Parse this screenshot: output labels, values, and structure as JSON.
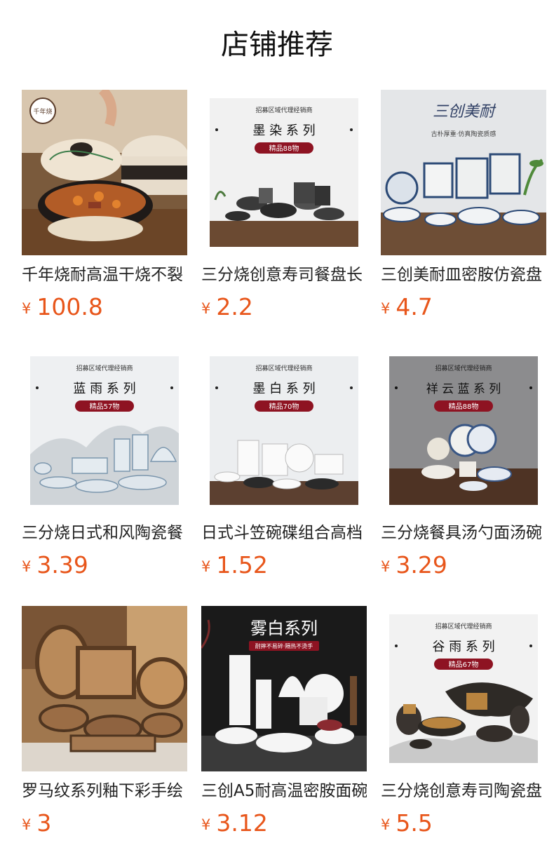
{
  "header": {
    "title": "店铺推荐"
  },
  "currency": "¥",
  "products": [
    {
      "name": "千年烧耐高温干烧不裂",
      "price": "100.8"
    },
    {
      "name": "三分烧创意寿司餐盘长",
      "price": "2.2"
    },
    {
      "name": "三创美耐皿密胺仿瓷盘",
      "price": "4.7"
    },
    {
      "name": "三分烧日式和风陶瓷餐",
      "price": "3.39"
    },
    {
      "name": "日式斗笠碗碟组合高档",
      "price": "1.52"
    },
    {
      "name": "三分烧餐具汤勺面汤碗",
      "price": "3.29"
    },
    {
      "name": "罗马纹系列釉下彩手绘",
      "price": "3"
    },
    {
      "name": "三创A5耐高温密胺面碗",
      "price": "3.12"
    },
    {
      "name": "三分烧创意寿司陶瓷盘",
      "price": "5.5"
    }
  ],
  "banners": {
    "moran": {
      "top": "招募区域代理经销商",
      "series": "墨 染 系 列",
      "badge": "精品88物"
    },
    "sanchuang": {
      "logo": "三创美耐",
      "sub": "古朴厚重·仿真陶瓷质感"
    },
    "lanyu": {
      "top": "招募区域代理经销商",
      "series": "蓝 雨 系 列",
      "badge": "精品57物"
    },
    "mobai": {
      "top": "招募区域代理经销商",
      "series": "墨 白 系 列",
      "badge": "精品70物"
    },
    "xiangyun": {
      "top": "招募区域代理经销商",
      "series": "祥 云 蓝 系 列",
      "badge": "精品88物"
    },
    "wubai": {
      "series": "雾白系列",
      "tag": "耐摔不易碎·隔热不烫手"
    },
    "guyu": {
      "top": "招募区域代理经销商",
      "series": "谷 雨 系 列",
      "badge": "精品67物"
    },
    "qiannian": {
      "stamp": "千年烧"
    }
  },
  "colors": {
    "price": "#e8561b",
    "badge": "#8e1322"
  }
}
